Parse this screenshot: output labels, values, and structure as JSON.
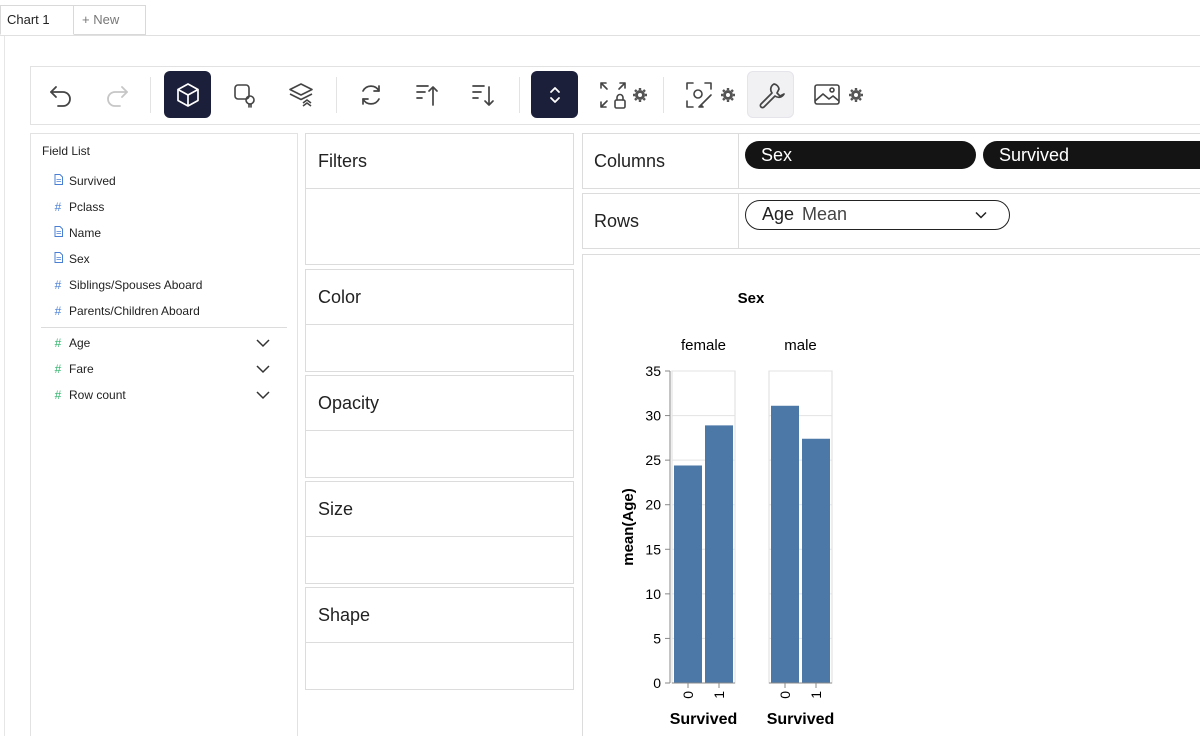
{
  "tabs": [
    {
      "label": "Chart 1"
    },
    {
      "label": "+ New"
    }
  ],
  "toolbar": {
    "buttons": [
      {
        "icon": "undo-icon"
      },
      {
        "icon": "redo-icon"
      },
      {
        "icon": "cube-icon",
        "active": true
      },
      {
        "icon": "brush-bulb-icon"
      },
      {
        "icon": "layers-icon"
      },
      {
        "icon": "refresh-icon"
      },
      {
        "icon": "sort-ascending-icon"
      },
      {
        "icon": "sort-descending-icon"
      },
      {
        "icon": "expand-collapse-icon",
        "active": true
      },
      {
        "icon": "fullscreen-lock-icon"
      },
      {
        "icon": "focus-brush-icon"
      },
      {
        "icon": "wrench-icon"
      },
      {
        "icon": "image-icon"
      }
    ]
  },
  "field_list": {
    "title": "Field List",
    "dimensions": [
      {
        "label": "Survived",
        "icon": "document-icon"
      },
      {
        "label": "Pclass",
        "icon": "hash-icon"
      },
      {
        "label": "Name",
        "icon": "document-icon"
      },
      {
        "label": "Sex",
        "icon": "document-icon"
      },
      {
        "label": "Siblings/Spouses Aboard",
        "icon": "hash-icon"
      },
      {
        "label": "Parents/Children Aboard",
        "icon": "hash-icon"
      }
    ],
    "measures": [
      {
        "label": "Age",
        "icon": "hash-icon"
      },
      {
        "label": "Fare",
        "icon": "hash-icon"
      },
      {
        "label": "Row count",
        "icon": "hash-icon"
      }
    ]
  },
  "encodings": {
    "filters": "Filters",
    "color": "Color",
    "opacity": "Opacity",
    "size": "Size",
    "shape": "Shape"
  },
  "shelves": {
    "columns_label": "Columns",
    "columns_pills": [
      "Sex",
      "Survived"
    ],
    "rows_label": "Rows",
    "rows_pill": {
      "field": "Age",
      "aggregation": "Mean"
    }
  },
  "colors": {
    "accent_dark": "#1c1f3a",
    "bar": "#4c78a8",
    "dimension_icon": "#4a7fd6",
    "measure_icon": "#2fb36b"
  },
  "chart_data": {
    "type": "bar",
    "title": "Sex",
    "ylabel": "mean(Age)",
    "xlabel": "Survived",
    "ylim": [
      0,
      35
    ],
    "yticks": [
      0,
      5,
      10,
      15,
      20,
      25,
      30,
      35
    ],
    "categories": [
      "0",
      "1"
    ],
    "facets": [
      {
        "name": "female",
        "values": [
          24.4,
          28.9
        ]
      },
      {
        "name": "male",
        "values": [
          31.1,
          27.4
        ]
      }
    ]
  }
}
